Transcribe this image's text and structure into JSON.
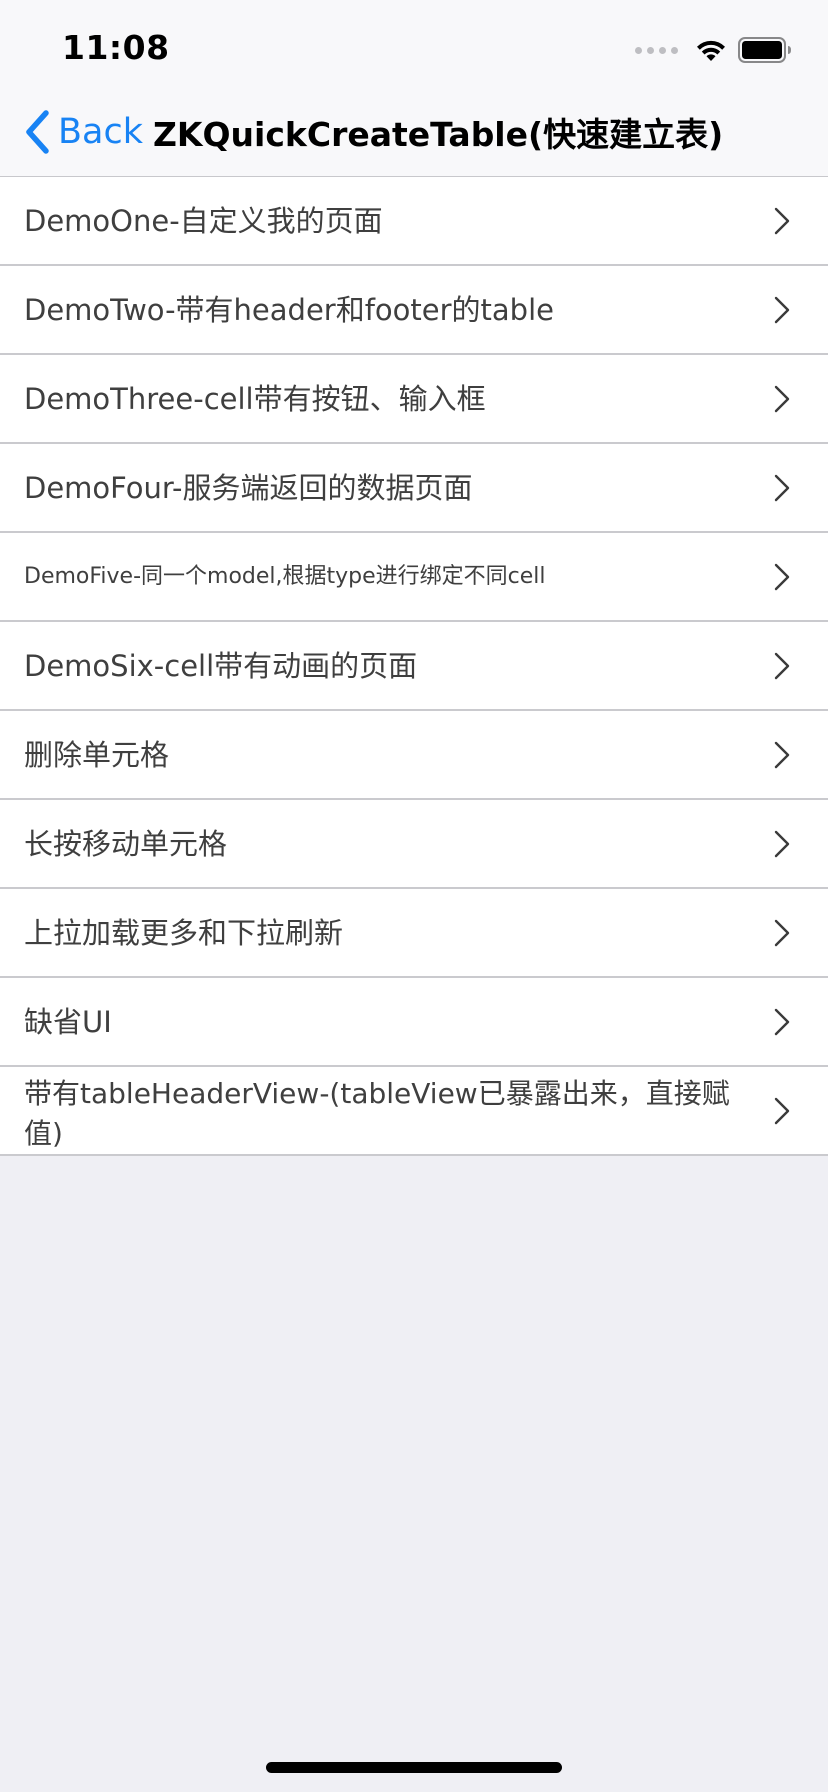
{
  "status_bar": {
    "time": "11:08"
  },
  "nav": {
    "back_label": "Back",
    "title": "ZKQuickCreateTable(快速建立表)"
  },
  "table": {
    "rows": [
      {
        "label": "DemoOne-自定义我的页面"
      },
      {
        "label": "DemoTwo-带有header和footer的table"
      },
      {
        "label": "DemoThree-cell带有按钮、输入框"
      },
      {
        "label": "DemoFour-服务端返回的数据页面"
      },
      {
        "label": "DemoFive-同一个model,根据type进行绑定不同cell"
      },
      {
        "label": "DemoSix-cell带有动画的页面"
      },
      {
        "label": "删除单元格"
      },
      {
        "label": "长按移动单元格"
      },
      {
        "label": "上拉加载更多和下拉刷新"
      },
      {
        "label": "缺省UI"
      },
      {
        "label": "带有tableHeaderView-(tableView已暴露出来，直接赋值)"
      }
    ]
  },
  "colors": {
    "accent": "#1883F4",
    "background": "#EFEFF4",
    "row_text": "#3F3F3F",
    "separator": "#CACACE"
  },
  "icons": {
    "back": "chevron-left-icon",
    "disclosure": "chevron-right-icon",
    "wifi": "wifi-icon",
    "battery": "battery-icon",
    "signal": "signal-icon"
  }
}
